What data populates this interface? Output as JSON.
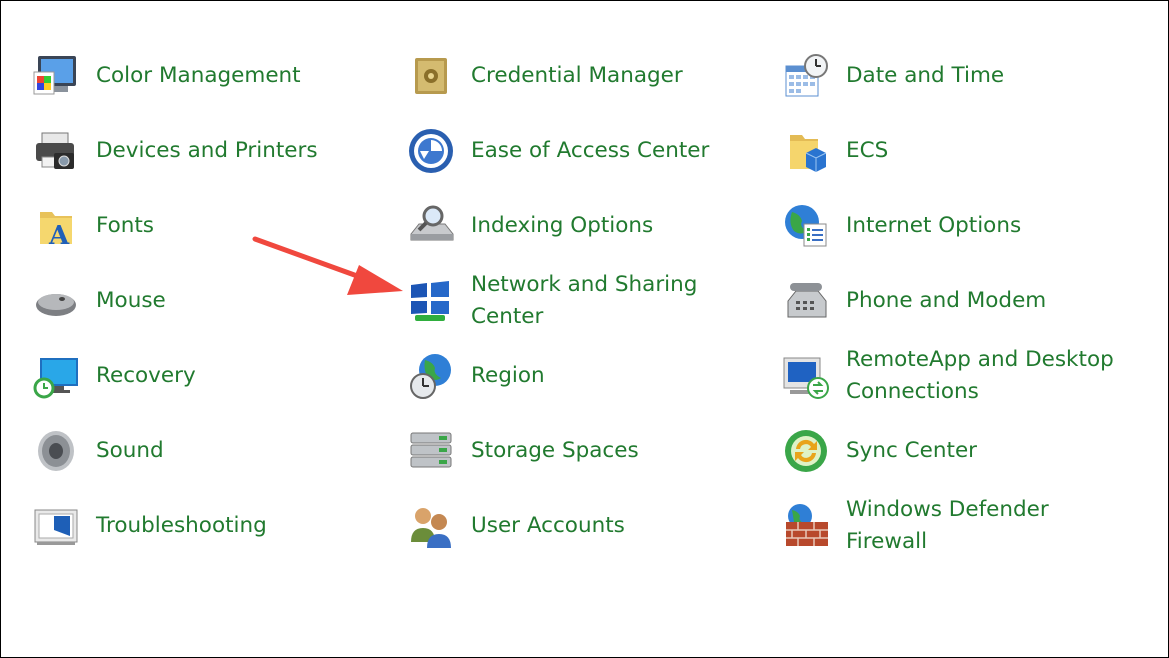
{
  "items": [
    {
      "label": "Color Management",
      "icon": "color-management-icon"
    },
    {
      "label": "Devices and Printers",
      "icon": "devices-printers-icon"
    },
    {
      "label": "Fonts",
      "icon": "fonts-icon"
    },
    {
      "label": "Mouse",
      "icon": "mouse-icon"
    },
    {
      "label": "Recovery",
      "icon": "recovery-icon"
    },
    {
      "label": "Sound",
      "icon": "sound-icon"
    },
    {
      "label": "Troubleshooting",
      "icon": "troubleshooting-icon"
    },
    {
      "label": "Credential Manager",
      "icon": "credential-manager-icon"
    },
    {
      "label": "Ease of Access Center",
      "icon": "ease-of-access-icon"
    },
    {
      "label": "Indexing Options",
      "icon": "indexing-options-icon"
    },
    {
      "label": "Network and Sharing Center",
      "icon": "network-sharing-icon"
    },
    {
      "label": "Region",
      "icon": "region-icon"
    },
    {
      "label": "Storage Spaces",
      "icon": "storage-spaces-icon"
    },
    {
      "label": "User Accounts",
      "icon": "user-accounts-icon"
    },
    {
      "label": "Date and Time",
      "icon": "date-time-icon"
    },
    {
      "label": "ECS",
      "icon": "ecs-folder-icon"
    },
    {
      "label": "Internet Options",
      "icon": "internet-options-icon"
    },
    {
      "label": "Phone and Modem",
      "icon": "phone-modem-icon"
    },
    {
      "label": "RemoteApp and Desktop Connections",
      "icon": "remoteapp-icon"
    },
    {
      "label": "Sync Center",
      "icon": "sync-center-icon"
    },
    {
      "label": "Windows Defender Firewall",
      "icon": "firewall-icon"
    }
  ],
  "colors": {
    "link": "#217a2f",
    "annotation_arrow": "#f0483e"
  }
}
